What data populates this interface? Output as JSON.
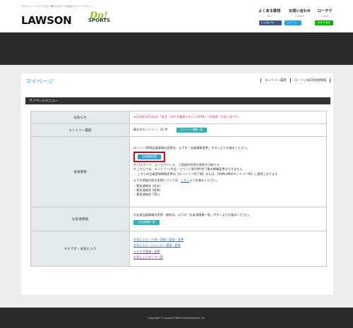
{
  "header": {
    "tagline": "マラソン・トライアスロン等のスポーツ大会のエントリーサイト",
    "logo": {
      "main": "LAWSON",
      "accent": "Do!",
      "sub": "SPORTS"
    },
    "nav": [
      {
        "label": "よくある質問",
        "sub": "FAQ"
      },
      {
        "label": "お問い合わせ",
        "sub": "CONTACT"
      },
      {
        "label": "ローチケ",
        "sub": "EVENT"
      }
    ],
    "share": {
      "facebook": "いいね! 32",
      "twitter": "ツイート",
      "line": "LINEで送る"
    }
  },
  "page": {
    "title": "マイページ",
    "links": [
      "エントリー履歴",
      "ローソンWEB会員情報"
    ],
    "menu_title": "マイページメニュー"
  },
  "rows": {
    "notice": {
      "label": "お知らせ",
      "text": "★2018/10/14(日)「東北・みやぎ復興マラソン2018」（宮城県）が本入金です。"
    },
    "history": {
      "label": "エントリー履歴",
      "text": "最近のエントリー：42 件",
      "button": "エントリー履歴一覧"
    },
    "member": {
      "label": "会員情報",
      "intro": "ローソンWEB会員情報の変更は、以下の「会員情報変更」ボタンよりお進みください。",
      "button": "会員情報変更",
      "notes": [
        "※ パスワード、メールアドレス、ご登録住所等の変更が可能です",
        "※ こちらでは、エントリー(大会・イベント受付時)完了後の情報変更はできません",
        "　 こちらの会員登録情報変更は【エントリー完了前】または、【同時以降のエントリー時】に適用となります"
      ],
      "change_prefix": "以下の登録内容の変更については、",
      "change_link": "こちら",
      "change_suffix": "よりお進みください。",
      "list": [
        "・緊急連絡先 (氏名)",
        "・緊急連絡先 (続柄)",
        "・緊急連絡先 (TEL)"
      ]
    },
    "friends": {
      "label": "お友達情報",
      "text": "お友達会員情報の変更・解除は、以下の「お友達情報一覧」ボタンよりお進みください。",
      "button": "お友達情報一覧"
    },
    "mail": {
      "label": "メルマガ・お気に入り",
      "links": [
        "お気に入り（人物・団体）登録・変更",
        "お気に入り（ジャンル）登録・変更",
        "メルマガ登録・変更",
        "お気に入りエリア一覧"
      ]
    }
  },
  "footer": {
    "copyright": "Copyright © Lawson HMV Entertainment, Inc."
  },
  "colors": {
    "accent": "#2ea7e0",
    "teal_button": "#29b5b5",
    "blue_button": "#2a9fd8",
    "highlight": "#e60012",
    "notice": "#e02f5e"
  }
}
